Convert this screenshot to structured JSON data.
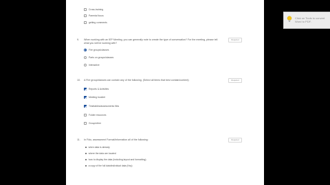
{
  "q0": {
    "options": [
      {
        "label": "Cross-training",
        "checked": false
      },
      {
        "label": "Parental focus",
        "checked": false
      },
      {
        "label": "getting comments",
        "checked": false
      }
    ]
  },
  "q1": {
    "number": "9.",
    "text": "When working with an IEP Meeting, you can generally note to create the type of conversation? For the meeting, please tell what you will be working with?",
    "tag": "Required",
    "options": [
      {
        "label": "Fire groups/classes",
        "selected": true
      },
      {
        "label": "Parts on groups/classes",
        "selected": false
      },
      {
        "label": "Interactive",
        "selected": false
      }
    ]
  },
  "q2": {
    "number": "10.",
    "text": "A Fire group/classes can contain any of the following. (Select all items that best contain/content):",
    "tag": "Required",
    "options": [
      {
        "label": "Reports & Activities",
        "checked": true
      },
      {
        "label": "Meeting booklet",
        "checked": true
      },
      {
        "label": "Timetables/assessments files",
        "checked": true
      },
      {
        "label": "Folder resources",
        "checked": false
      },
      {
        "label": "Group/other",
        "checked": false
      }
    ]
  },
  "q3": {
    "number": "11.",
    "text": "In Fido, assessment Formal/information all of the following:",
    "tag": "Required",
    "bullets": [
      "when data is already",
      "where the data are located",
      "how to display the data (including layout and formatting)",
      "a copy of the full data/individual data (Key)"
    ]
  },
  "toast": {
    "text": "Click on Tools to convert Word to PDF."
  }
}
